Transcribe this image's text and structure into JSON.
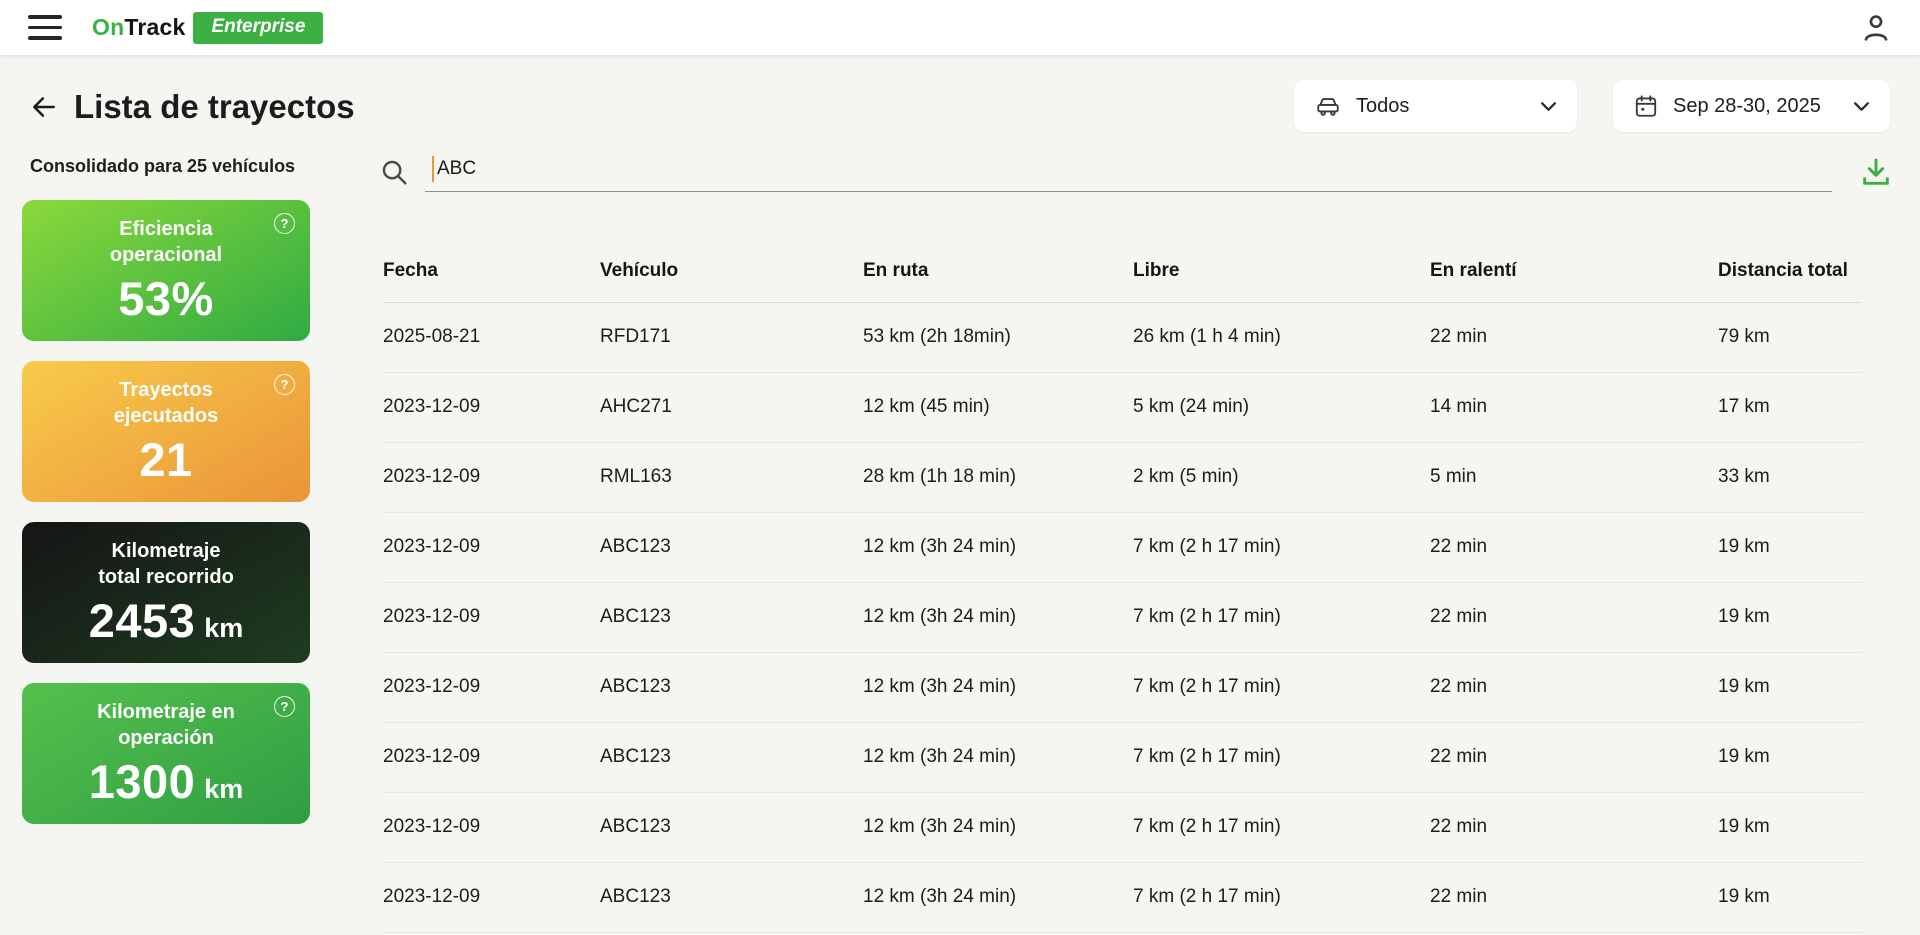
{
  "topbar": {
    "brand": {
      "on": "On",
      "track": "Track",
      "badge": "Enterprise"
    }
  },
  "header": {
    "title": "Lista de trayectos",
    "subtitle": "Consolidado para 25 vehículos",
    "filters": {
      "vehicle": {
        "label": "Todos"
      },
      "date": {
        "label": "Sep 28-30, 2025"
      }
    }
  },
  "search": {
    "value": "ABC"
  },
  "kpi_cards": [
    {
      "title_lines": [
        "Eficiencia",
        "operacional"
      ],
      "value": "53%",
      "unit": "",
      "help": true,
      "gradient": [
        "#8bd93b",
        "#2fab43"
      ]
    },
    {
      "title_lines": [
        "Trayectos",
        "ejecutados"
      ],
      "value": "21",
      "unit": "",
      "help": true,
      "gradient": [
        "#f8cb4b",
        "#ea9438"
      ]
    },
    {
      "title_lines": [
        "Kilometraje",
        "total recorrido"
      ],
      "value": "2453",
      "unit": "km",
      "help": false,
      "gradient": [
        "#151515",
        "#1e3c20"
      ]
    },
    {
      "title_lines": [
        "Kilometraje en",
        "operación"
      ],
      "value": "1300",
      "unit": "km",
      "help": true,
      "gradient": [
        "#55c04c",
        "#2f9e44"
      ]
    }
  ],
  "table": {
    "columns": [
      "Fecha",
      "Vehículo",
      "En ruta",
      "Libre",
      "En ralentí",
      "Distancia total"
    ],
    "rows": [
      [
        "2025-08-21",
        "RFD171",
        "53 km (2h 18min)",
        "26 km (1 h 4 min)",
        "22 min",
        "79 km"
      ],
      [
        "2023-12-09",
        "AHC271",
        "12 km (45 min)",
        "5 km (24 min)",
        "14 min",
        "17 km"
      ],
      [
        "2023-12-09",
        "RML163",
        "28 km (1h 18 min)",
        "2 km (5 min)",
        "5 min",
        "33 km"
      ],
      [
        "2023-12-09",
        "ABC123",
        "12 km (3h 24 min)",
        "7 km (2 h 17 min)",
        "22 min",
        "19 km"
      ],
      [
        "2023-12-09",
        "ABC123",
        "12 km (3h 24 min)",
        "7 km (2 h 17 min)",
        "22 min",
        "19 km"
      ],
      [
        "2023-12-09",
        "ABC123",
        "12 km (3h 24 min)",
        "7 km (2 h 17 min)",
        "22 min",
        "19 km"
      ],
      [
        "2023-12-09",
        "ABC123",
        "12 km (3h 24 min)",
        "7 km (2 h 17 min)",
        "22 min",
        "19 km"
      ],
      [
        "2023-12-09",
        "ABC123",
        "12 km (3h 24 min)",
        "7 km (2 h 17 min)",
        "22 min",
        "19 km"
      ],
      [
        "2023-12-09",
        "ABC123",
        "12 km (3h 24 min)",
        "7 km (2 h 17 min)",
        "22 min",
        "19 km"
      ]
    ]
  },
  "icons": {
    "help": "?"
  },
  "colors": {
    "brand_green": "#3cb043",
    "download_green": "#3fae47",
    "caret_orange": "#e59a3b",
    "page_bg": "#f5f5f2"
  }
}
